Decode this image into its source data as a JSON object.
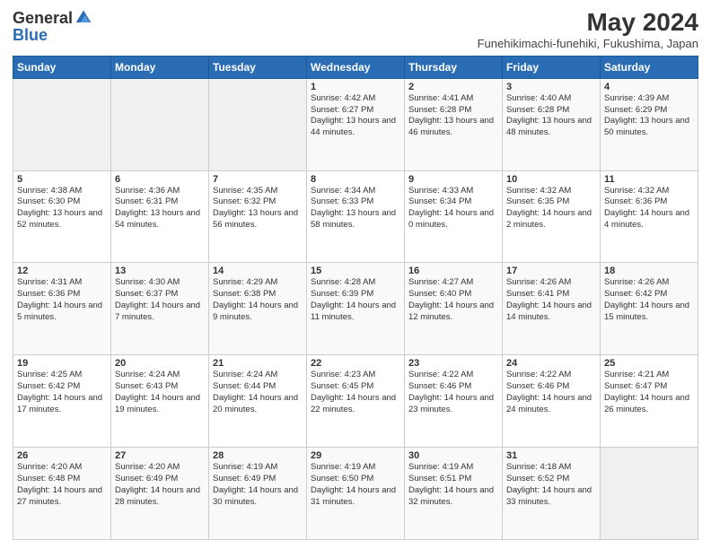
{
  "header": {
    "logo": {
      "general": "General",
      "blue": "Blue"
    },
    "title": "May 2024",
    "subtitle": "Funehikimachi-funehiki, Fukushima, Japan"
  },
  "days_of_week": [
    "Sunday",
    "Monday",
    "Tuesday",
    "Wednesday",
    "Thursday",
    "Friday",
    "Saturday"
  ],
  "weeks": [
    [
      {
        "day": "",
        "info": ""
      },
      {
        "day": "",
        "info": ""
      },
      {
        "day": "",
        "info": ""
      },
      {
        "day": "1",
        "info": "Sunrise: 4:42 AM\nSunset: 6:27 PM\nDaylight: 13 hours and 44 minutes."
      },
      {
        "day": "2",
        "info": "Sunrise: 4:41 AM\nSunset: 6:28 PM\nDaylight: 13 hours and 46 minutes."
      },
      {
        "day": "3",
        "info": "Sunrise: 4:40 AM\nSunset: 6:28 PM\nDaylight: 13 hours and 48 minutes."
      },
      {
        "day": "4",
        "info": "Sunrise: 4:39 AM\nSunset: 6:29 PM\nDaylight: 13 hours and 50 minutes."
      }
    ],
    [
      {
        "day": "5",
        "info": "Sunrise: 4:38 AM\nSunset: 6:30 PM\nDaylight: 13 hours and 52 minutes."
      },
      {
        "day": "6",
        "info": "Sunrise: 4:36 AM\nSunset: 6:31 PM\nDaylight: 13 hours and 54 minutes."
      },
      {
        "day": "7",
        "info": "Sunrise: 4:35 AM\nSunset: 6:32 PM\nDaylight: 13 hours and 56 minutes."
      },
      {
        "day": "8",
        "info": "Sunrise: 4:34 AM\nSunset: 6:33 PM\nDaylight: 13 hours and 58 minutes."
      },
      {
        "day": "9",
        "info": "Sunrise: 4:33 AM\nSunset: 6:34 PM\nDaylight: 14 hours and 0 minutes."
      },
      {
        "day": "10",
        "info": "Sunrise: 4:32 AM\nSunset: 6:35 PM\nDaylight: 14 hours and 2 minutes."
      },
      {
        "day": "11",
        "info": "Sunrise: 4:32 AM\nSunset: 6:36 PM\nDaylight: 14 hours and 4 minutes."
      }
    ],
    [
      {
        "day": "12",
        "info": "Sunrise: 4:31 AM\nSunset: 6:36 PM\nDaylight: 14 hours and 5 minutes."
      },
      {
        "day": "13",
        "info": "Sunrise: 4:30 AM\nSunset: 6:37 PM\nDaylight: 14 hours and 7 minutes."
      },
      {
        "day": "14",
        "info": "Sunrise: 4:29 AM\nSunset: 6:38 PM\nDaylight: 14 hours and 9 minutes."
      },
      {
        "day": "15",
        "info": "Sunrise: 4:28 AM\nSunset: 6:39 PM\nDaylight: 14 hours and 11 minutes."
      },
      {
        "day": "16",
        "info": "Sunrise: 4:27 AM\nSunset: 6:40 PM\nDaylight: 14 hours and 12 minutes."
      },
      {
        "day": "17",
        "info": "Sunrise: 4:26 AM\nSunset: 6:41 PM\nDaylight: 14 hours and 14 minutes."
      },
      {
        "day": "18",
        "info": "Sunrise: 4:26 AM\nSunset: 6:42 PM\nDaylight: 14 hours and 15 minutes."
      }
    ],
    [
      {
        "day": "19",
        "info": "Sunrise: 4:25 AM\nSunset: 6:42 PM\nDaylight: 14 hours and 17 minutes."
      },
      {
        "day": "20",
        "info": "Sunrise: 4:24 AM\nSunset: 6:43 PM\nDaylight: 14 hours and 19 minutes."
      },
      {
        "day": "21",
        "info": "Sunrise: 4:24 AM\nSunset: 6:44 PM\nDaylight: 14 hours and 20 minutes."
      },
      {
        "day": "22",
        "info": "Sunrise: 4:23 AM\nSunset: 6:45 PM\nDaylight: 14 hours and 22 minutes."
      },
      {
        "day": "23",
        "info": "Sunrise: 4:22 AM\nSunset: 6:46 PM\nDaylight: 14 hours and 23 minutes."
      },
      {
        "day": "24",
        "info": "Sunrise: 4:22 AM\nSunset: 6:46 PM\nDaylight: 14 hours and 24 minutes."
      },
      {
        "day": "25",
        "info": "Sunrise: 4:21 AM\nSunset: 6:47 PM\nDaylight: 14 hours and 26 minutes."
      }
    ],
    [
      {
        "day": "26",
        "info": "Sunrise: 4:20 AM\nSunset: 6:48 PM\nDaylight: 14 hours and 27 minutes."
      },
      {
        "day": "27",
        "info": "Sunrise: 4:20 AM\nSunset: 6:49 PM\nDaylight: 14 hours and 28 minutes."
      },
      {
        "day": "28",
        "info": "Sunrise: 4:19 AM\nSunset: 6:49 PM\nDaylight: 14 hours and 30 minutes."
      },
      {
        "day": "29",
        "info": "Sunrise: 4:19 AM\nSunset: 6:50 PM\nDaylight: 14 hours and 31 minutes."
      },
      {
        "day": "30",
        "info": "Sunrise: 4:19 AM\nSunset: 6:51 PM\nDaylight: 14 hours and 32 minutes."
      },
      {
        "day": "31",
        "info": "Sunrise: 4:18 AM\nSunset: 6:52 PM\nDaylight: 14 hours and 33 minutes."
      },
      {
        "day": "",
        "info": ""
      }
    ]
  ]
}
